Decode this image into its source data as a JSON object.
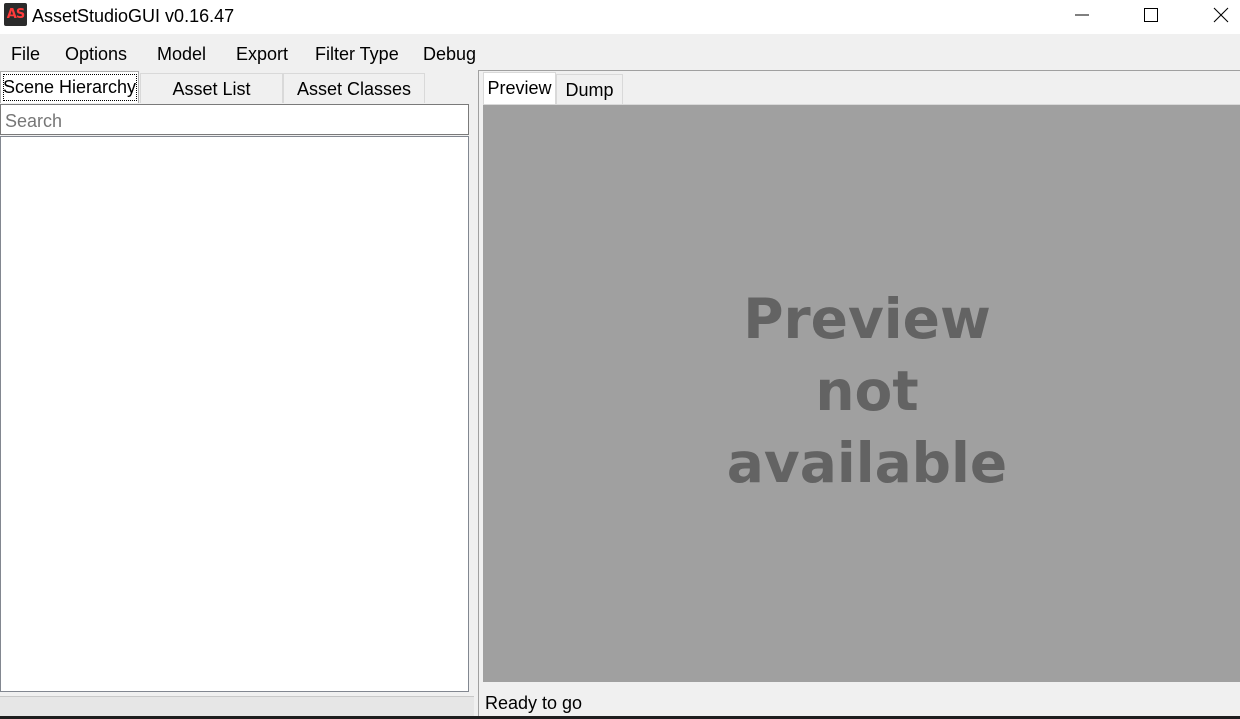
{
  "window": {
    "title": "AssetStudioGUI v0.16.47",
    "icon_label": "AS",
    "icon_name": "assetstudio-app-icon",
    "controls": [
      "minimize-icon",
      "maximize-icon",
      "close-icon"
    ]
  },
  "menu": {
    "items": [
      "File",
      "Options",
      "Model",
      "Export",
      "Filter Type",
      "Debug"
    ]
  },
  "left_panel": {
    "tabs": [
      "Scene Hierarchy",
      "Asset List",
      "Asset Classes"
    ],
    "active_tab": "Scene Hierarchy",
    "search": {
      "placeholder": "Search",
      "value": ""
    }
  },
  "right_panel": {
    "tabs": [
      "Preview",
      "Dump"
    ],
    "active_tab": "Preview",
    "preview_message": [
      "Preview",
      "not",
      "available"
    ]
  },
  "status": {
    "text": "Ready to go"
  },
  "colors": {
    "preview_background": "#a0a0a0",
    "preview_text": "#636363",
    "app_icon_accent": "#ff3b3b"
  }
}
